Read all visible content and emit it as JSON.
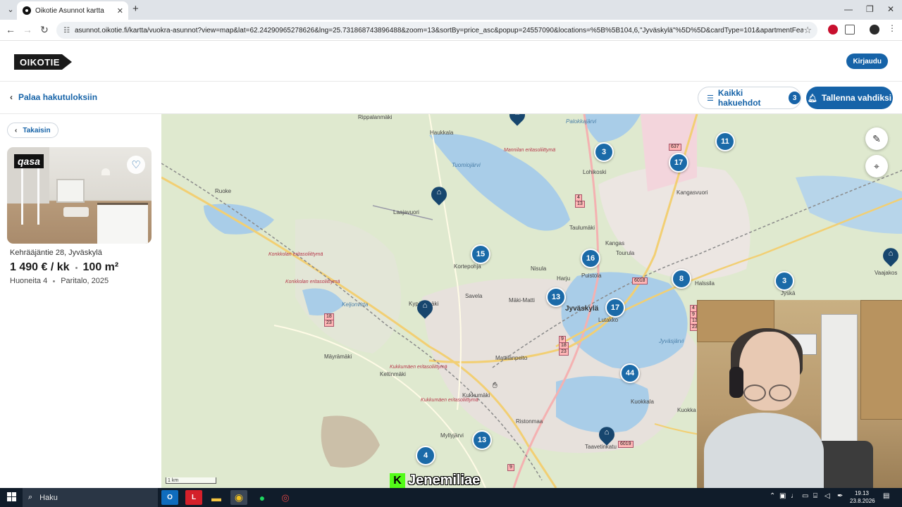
{
  "browser": {
    "tab_title": "Oikotie Asunnot kartta",
    "url": "asunnot.oikotie.fi/kartta/vuokra-asunnot?view=map&lat=62.24290965278626&lng=25.731868743896488&zoom=13&sortBy=price_asc&popup=24557090&locations=%5B%5B104,6,\"Jyväskylä\"%5D%5D&cardType=101&apartmentFeatures%5B%5D..."
  },
  "site": {
    "logo": "OIKOTIE",
    "login_label": "Kirjaudu"
  },
  "subheader": {
    "back_label": "Palaa hakutuloksiin",
    "all_filters_label": "Kaikki hakuehdot",
    "filter_count": "3",
    "save_watch_label": "Tallenna vahdiksi"
  },
  "panel": {
    "back_label": "Takaisin",
    "card": {
      "badge": "qasa",
      "address": "Kehrääjäntie 28, Jyväskylä",
      "price": "1 490 € / kk",
      "size": "100 m²",
      "rooms": "Huoneita 4",
      "type_year": "Paritalo, 2025"
    }
  },
  "map": {
    "clusters": [
      "3",
      "17",
      "11",
      "15",
      "16",
      "8",
      "3",
      "13",
      "17",
      "44",
      "13",
      "4"
    ],
    "places": {
      "rippalanmaki": "Rippalanmäki",
      "haukkala": "Haukkala",
      "ruoke": "Ruoke",
      "laajavuori": "Laajavuori",
      "lohikoski": "Lohikoski",
      "kangasvuori": "Kangasvuori",
      "taulumaki": "Taulumäki",
      "kangas": "Kangas",
      "tourula": "Tourula",
      "kortepohja": "Kortepohja",
      "nisula": "Nisula",
      "harju": "Harju",
      "puistola": "Puistola",
      "halssila": "Halssila",
      "jyska": "Jyskä",
      "savela": "Savela",
      "makimatti": "Mäki-Matti",
      "jyvaskyla": "Jyväskylä",
      "lutakko": "Lutakko",
      "kyparamaki": "Kypärämäki",
      "mayramaki": "Mäyrämäki",
      "keltinmaki": "Keltinmäki",
      "mattilanpelto": "Mattilanpelto",
      "kukkumaki": "Kukkumäki",
      "kuokkala": "Kuokkala",
      "kuokka": "Kuokka",
      "ristonmaa": "Ristonmaa",
      "myllyjarvi": "Myllyjärvi",
      "vaajakoski": "Vaajakos",
      "tuomiojarvi": "Tuomiojärvi",
      "jyvasjarvi": "Jyväsjärvi",
      "palokkajarvi": "Palokkajärvi",
      "keljonvirta": "Keljonvirta",
      "taavetinkatu": "Taavetinkatu",
      "monnilan": "Mannilan eritasoliittymä",
      "konkkolan1": "Konkkolan eritasoliittymä",
      "konkkolan2": "Konkkolan eritasoliittymä",
      "kukkumaen1": "Kukkumäen eritasoliittymä",
      "kukkumaen2": "Kukkumäen eritasoliittymä"
    },
    "road_numbers": {
      "r4a": "4",
      "r13a": "13",
      "r637": "637",
      "r6018": "6018",
      "r18": "18",
      "r23": "23",
      "r9": "9",
      "r18b": "18",
      "r23b": "23",
      "r4b": "4",
      "r9b": "9",
      "r13b": "13",
      "r23c": "23",
      "r6019": "6019",
      "r9c": "9"
    },
    "scale_label": "1 km"
  },
  "stream": {
    "overlay_name": "Jenemiliae",
    "logo_letter": "K"
  },
  "taskbar": {
    "search_label": "Haku",
    "time": "19.13",
    "date": "23.8.2026"
  },
  "colors": {
    "accent": "#1663a8",
    "cluster": "#1b6aa8",
    "pin": "#17466e"
  }
}
